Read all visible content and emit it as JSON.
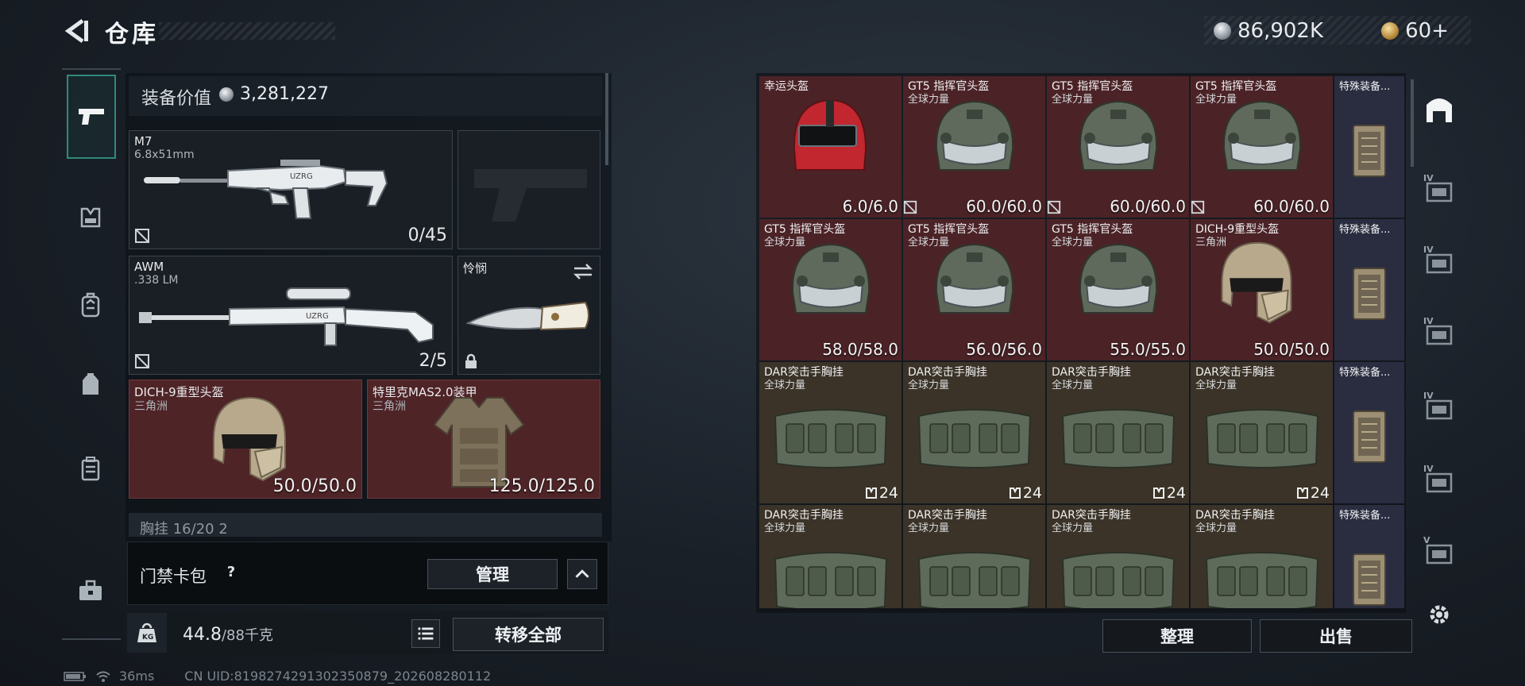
{
  "header": {
    "title": "仓库",
    "currency_main": "86,902K",
    "currency_secondary": "60+"
  },
  "left_nav": [
    "pistol-icon",
    "armor-vest-icon",
    "backpack-icon",
    "chest-rig-icon",
    "case-icon",
    "toolbox-icon"
  ],
  "loadout": {
    "value_label": "装备价值",
    "value": "3,281,227",
    "primary": {
      "name": "M7",
      "caliber": "6.8x51mm",
      "ammo": "0/45"
    },
    "secondary": {
      "name": "AWM",
      "caliber": ".338 LM",
      "ammo": "2/5"
    },
    "melee": {
      "name": "怜悯"
    },
    "helmet": {
      "name": "DICH-9重型头盔",
      "source": "三角洲",
      "durability": "50.0/50.0"
    },
    "armor": {
      "name": "特里克MAS2.0装甲",
      "source": "三角洲",
      "durability": "125.0/125.0"
    },
    "chest_rig_cutoff": "胸挂 16/20 2",
    "card_pack_label": "门禁卡包",
    "help": "?",
    "manage_button": "管理",
    "weight": "44.8",
    "weight_max": "/88千克",
    "transfer_all_button": "转移全部"
  },
  "status": {
    "ping": "36ms",
    "uid": "CN UID:8198274291302350879_202608280112"
  },
  "grid": {
    "special_label": "特殊装备...",
    "rows": [
      [
        {
          "name": "幸运头盔",
          "sub": "",
          "value": "6.0/6.0",
          "type": "lucky",
          "broken": false
        },
        {
          "name": "GT5 指挥官头盔",
          "sub": "全球力量",
          "value": "60.0/60.0",
          "type": "gt5",
          "broken": true
        },
        {
          "name": "GT5 指挥官头盔",
          "sub": "全球力量",
          "value": "60.0/60.0",
          "type": "gt5",
          "broken": true
        },
        {
          "name": "GT5 指挥官头盔",
          "sub": "全球力量",
          "value": "60.0/60.0",
          "type": "gt5",
          "broken": true
        }
      ],
      [
        {
          "name": "GT5 指挥官头盔",
          "sub": "全球力量",
          "value": "58.0/58.0",
          "type": "gt5",
          "broken": false
        },
        {
          "name": "GT5 指挥官头盔",
          "sub": "全球力量",
          "value": "56.0/56.0",
          "type": "gt5",
          "broken": false
        },
        {
          "name": "GT5 指挥官头盔",
          "sub": "全球力量",
          "value": "55.0/55.0",
          "type": "gt5",
          "broken": false
        },
        {
          "name": "DICH-9重型头盔",
          "sub": "三角洲",
          "value": "50.0/50.0",
          "type": "dich",
          "broken": false
        }
      ],
      [
        {
          "name": "DAR突击手胸挂",
          "sub": "全球力量",
          "capacity": "24",
          "type": "rig"
        },
        {
          "name": "DAR突击手胸挂",
          "sub": "全球力量",
          "capacity": "24",
          "type": "rig"
        },
        {
          "name": "DAR突击手胸挂",
          "sub": "全球力量",
          "capacity": "24",
          "type": "rig"
        },
        {
          "name": "DAR突击手胸挂",
          "sub": "全球力量",
          "capacity": "24",
          "type": "rig"
        }
      ],
      [
        {
          "name": "DAR突击手胸挂",
          "sub": "全球力量",
          "capacity": "",
          "type": "rig"
        },
        {
          "name": "DAR突击手胸挂",
          "sub": "全球力量",
          "capacity": "",
          "type": "rig"
        },
        {
          "name": "DAR突击手胸挂",
          "sub": "全球力量",
          "capacity": "",
          "type": "rig"
        },
        {
          "name": "DAR突击手胸挂",
          "sub": "全球力量",
          "capacity": "",
          "type": "rig"
        }
      ]
    ],
    "sort_button": "整理",
    "sell_button": "出售"
  },
  "right_nav": [
    {
      "icon": "warehouse-icon",
      "level": ""
    },
    {
      "icon": "storage-iv-icon",
      "level": "IV"
    },
    {
      "icon": "storage-iv-icon",
      "level": "IV"
    },
    {
      "icon": "storage-iv-icon",
      "level": "IV"
    },
    {
      "icon": "storage-iv-icon",
      "level": "IV"
    },
    {
      "icon": "storage-iv-icon",
      "level": "IV"
    },
    {
      "icon": "storage-v-icon",
      "level": "V"
    },
    {
      "icon": "settings-gear-icon",
      "level": ""
    }
  ],
  "colors": {
    "slot_red": "#4b2327",
    "slot_olive": "#3b3328",
    "slot_blue": "#2a2d40",
    "active_nav": "#2f8a7a"
  }
}
